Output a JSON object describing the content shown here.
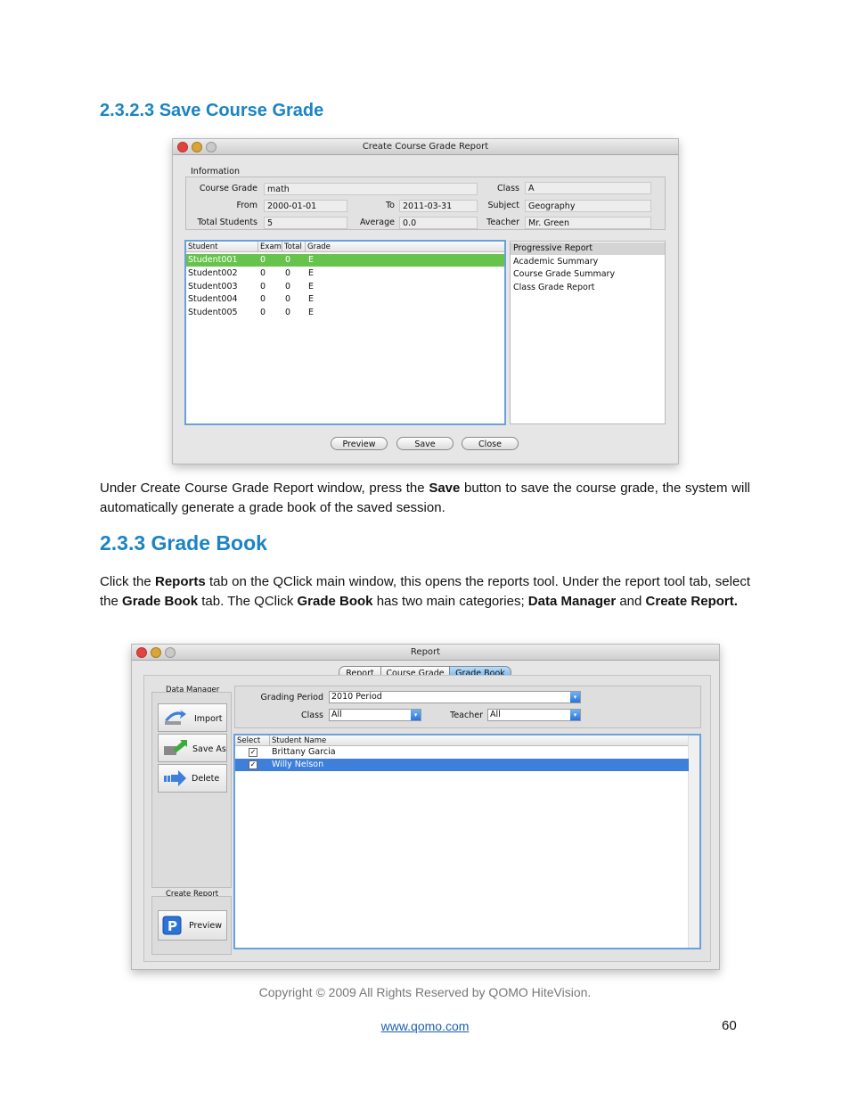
{
  "section_heading": "2.3.2.3 Save Course Grade",
  "window1": {
    "title": "Create Course Grade Report",
    "info_group_label": "Information",
    "fields": {
      "course_grade_label": "Course Grade",
      "course_grade_value": "math",
      "class_label": "Class",
      "class_value": "A",
      "from_label": "From",
      "from_value": "2000-01-01",
      "to_label": "To",
      "to_value": "2011-03-31",
      "subject_label": "Subject",
      "subject_value": "Geography",
      "total_students_label": "Total Students",
      "total_students_value": "5",
      "average_label": "Average",
      "average_value": "0.0",
      "teacher_label": "Teacher",
      "teacher_value": "Mr. Green"
    },
    "table_headers": [
      "Student",
      "Exam",
      "Total",
      "Grade"
    ],
    "rows": [
      {
        "student": "Student001",
        "exam": "0",
        "total": "0",
        "grade": "E"
      },
      {
        "student": "Student002",
        "exam": "0",
        "total": "0",
        "grade": "E"
      },
      {
        "student": "Student003",
        "exam": "0",
        "total": "0",
        "grade": "E"
      },
      {
        "student": "Student004",
        "exam": "0",
        "total": "0",
        "grade": "E"
      },
      {
        "student": "Student005",
        "exam": "0",
        "total": "0",
        "grade": "E"
      }
    ],
    "report_types": [
      "Progressive Report",
      "Academic Summary",
      "Course Grade Summary",
      "Class Grade Report"
    ],
    "buttons": {
      "preview": "Preview",
      "save": "Save",
      "close": "Close"
    },
    "selected_row_color": "#66c34b"
  },
  "para1": {
    "a": "Under Create Course Grade Report window, press the ",
    "b": "Save",
    "c": " button to save the course grade, the system will automatically generate a grade book of the saved session."
  },
  "section2_heading": "2.3.3 Grade Book",
  "para2": {
    "a": "Click the ",
    "b": "Reports",
    "c": " tab on the QClick main window, this opens the reports tool. Under the report tool tab, select the ",
    "d": "Grade Book",
    "e": " tab. The QClick ",
    "f": "Grade Book",
    "g": " has two main categories; ",
    "h": "Data Manager",
    "i": " and ",
    "j": "Create Report."
  },
  "window2": {
    "title": "Report",
    "tabs": [
      "Report",
      "Course Grade",
      "Grade Book"
    ],
    "active_tab": "Grade Book",
    "data_manager_label": "Data Manager",
    "side_buttons": {
      "import": "Import",
      "save_as": "Save As",
      "delete": "Delete"
    },
    "create_report_label": "Create Report",
    "preview_button": "Preview",
    "grading_period_label": "Grading Period",
    "grading_period_value": "2010 Period",
    "class_label": "Class",
    "class_value": "All",
    "teacher_label": "Teacher",
    "teacher_value": "All",
    "list_headers": [
      "Select",
      "Student Name"
    ],
    "students": [
      {
        "name": "Brittany Garcia",
        "checked": true
      },
      {
        "name": "Willy Nelson",
        "checked": true
      }
    ],
    "selected_row_color": "#3d7fd9"
  },
  "footer": {
    "copyright": "Copyright © 2009 All Rights Reserved by QOMO HiteVision.",
    "website": "www.qomo.com",
    "page_number": "60"
  }
}
